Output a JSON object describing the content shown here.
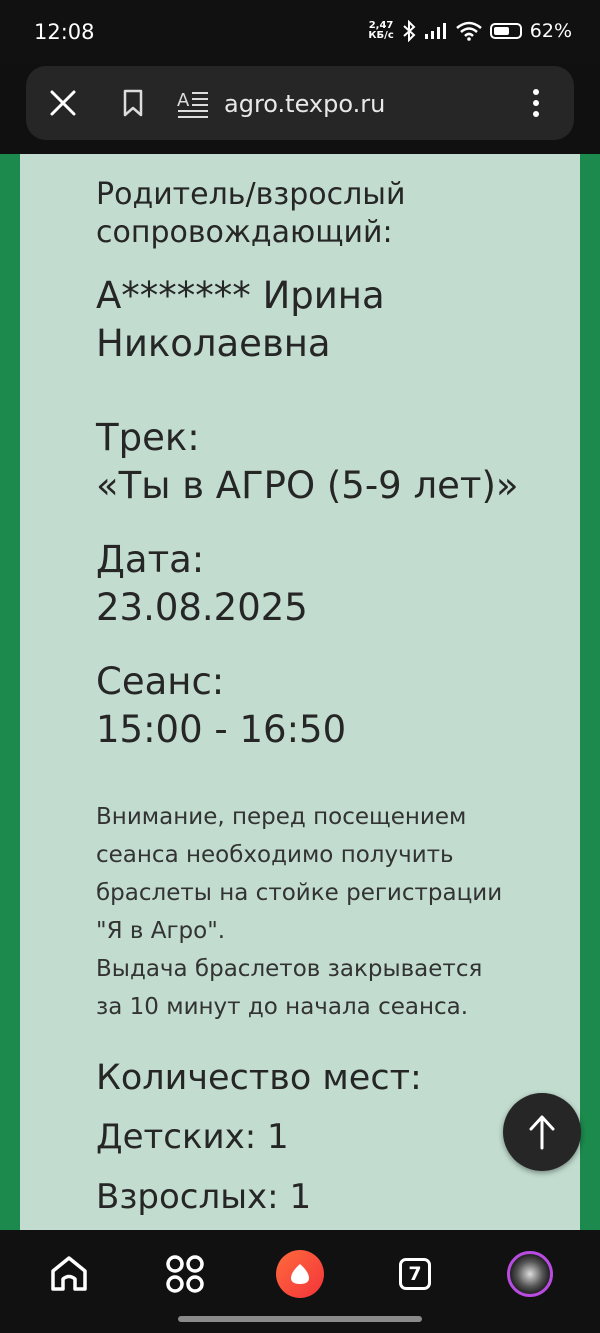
{
  "status_bar": {
    "time": "12:08",
    "speed_value": "2,47",
    "speed_unit": "КБ/с",
    "battery": "62%",
    "battery_level": 0.62
  },
  "browser": {
    "url": "agro.texpo.ru"
  },
  "ticket": {
    "parent_label_1": "Родитель/взрослый",
    "parent_label_2": "сопровождающий:",
    "parent_name_1": "А******* Ирина",
    "parent_name_2": "Николаевна",
    "track_label": "Трек:",
    "track_value": "«Ты в АГРО (5-9 лет)»",
    "date_label": "Дата:",
    "date_value": "23.08.2025",
    "session_label": "Сеанс:",
    "session_value": "15:00 - 16:50",
    "notice_lines": [
      "Внимание, перед посещением",
      "сеанса необходимо получить",
      "браслеты на стойке регистрации",
      "\"Я в Агро\".",
      "Выдача браслетов закрывается",
      "за 10 минут до начала сеанса."
    ],
    "seats_title": "Количество мест:",
    "children_label": "Детских: 1",
    "adults_label": "Взрослых: 1"
  },
  "nav": {
    "tabs_count": "7"
  },
  "colors": {
    "page_green": "#1c8a4d",
    "card_bg": "#c2ddd0"
  }
}
